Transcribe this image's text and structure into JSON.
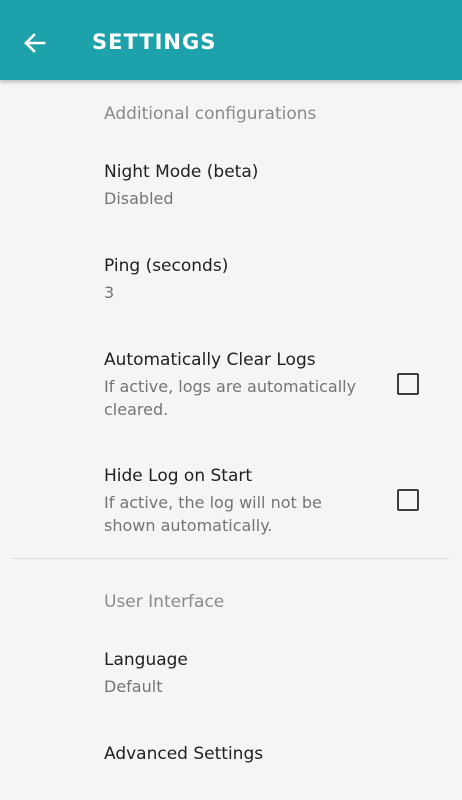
{
  "toolbar": {
    "title": "Settings",
    "back_icon": "arrow-left-icon",
    "color": "#1da2ab"
  },
  "sections": [
    {
      "header": "Additional configurations",
      "items": [
        {
          "title": "Night Mode (beta)",
          "summary": "Disabled"
        },
        {
          "title": "Ping (seconds)",
          "summary": "3"
        },
        {
          "title": "Automatically Clear Logs",
          "summary": "If active, logs are automatically cleared.",
          "checked": false
        },
        {
          "title": "Hide Log on Start",
          "summary": "If active, the log will not be shown automatically.",
          "checked": false
        }
      ]
    },
    {
      "header": "User Interface",
      "items": [
        {
          "title": "Language",
          "summary": "Default"
        },
        {
          "title": "Advanced Settings"
        }
      ]
    }
  ]
}
